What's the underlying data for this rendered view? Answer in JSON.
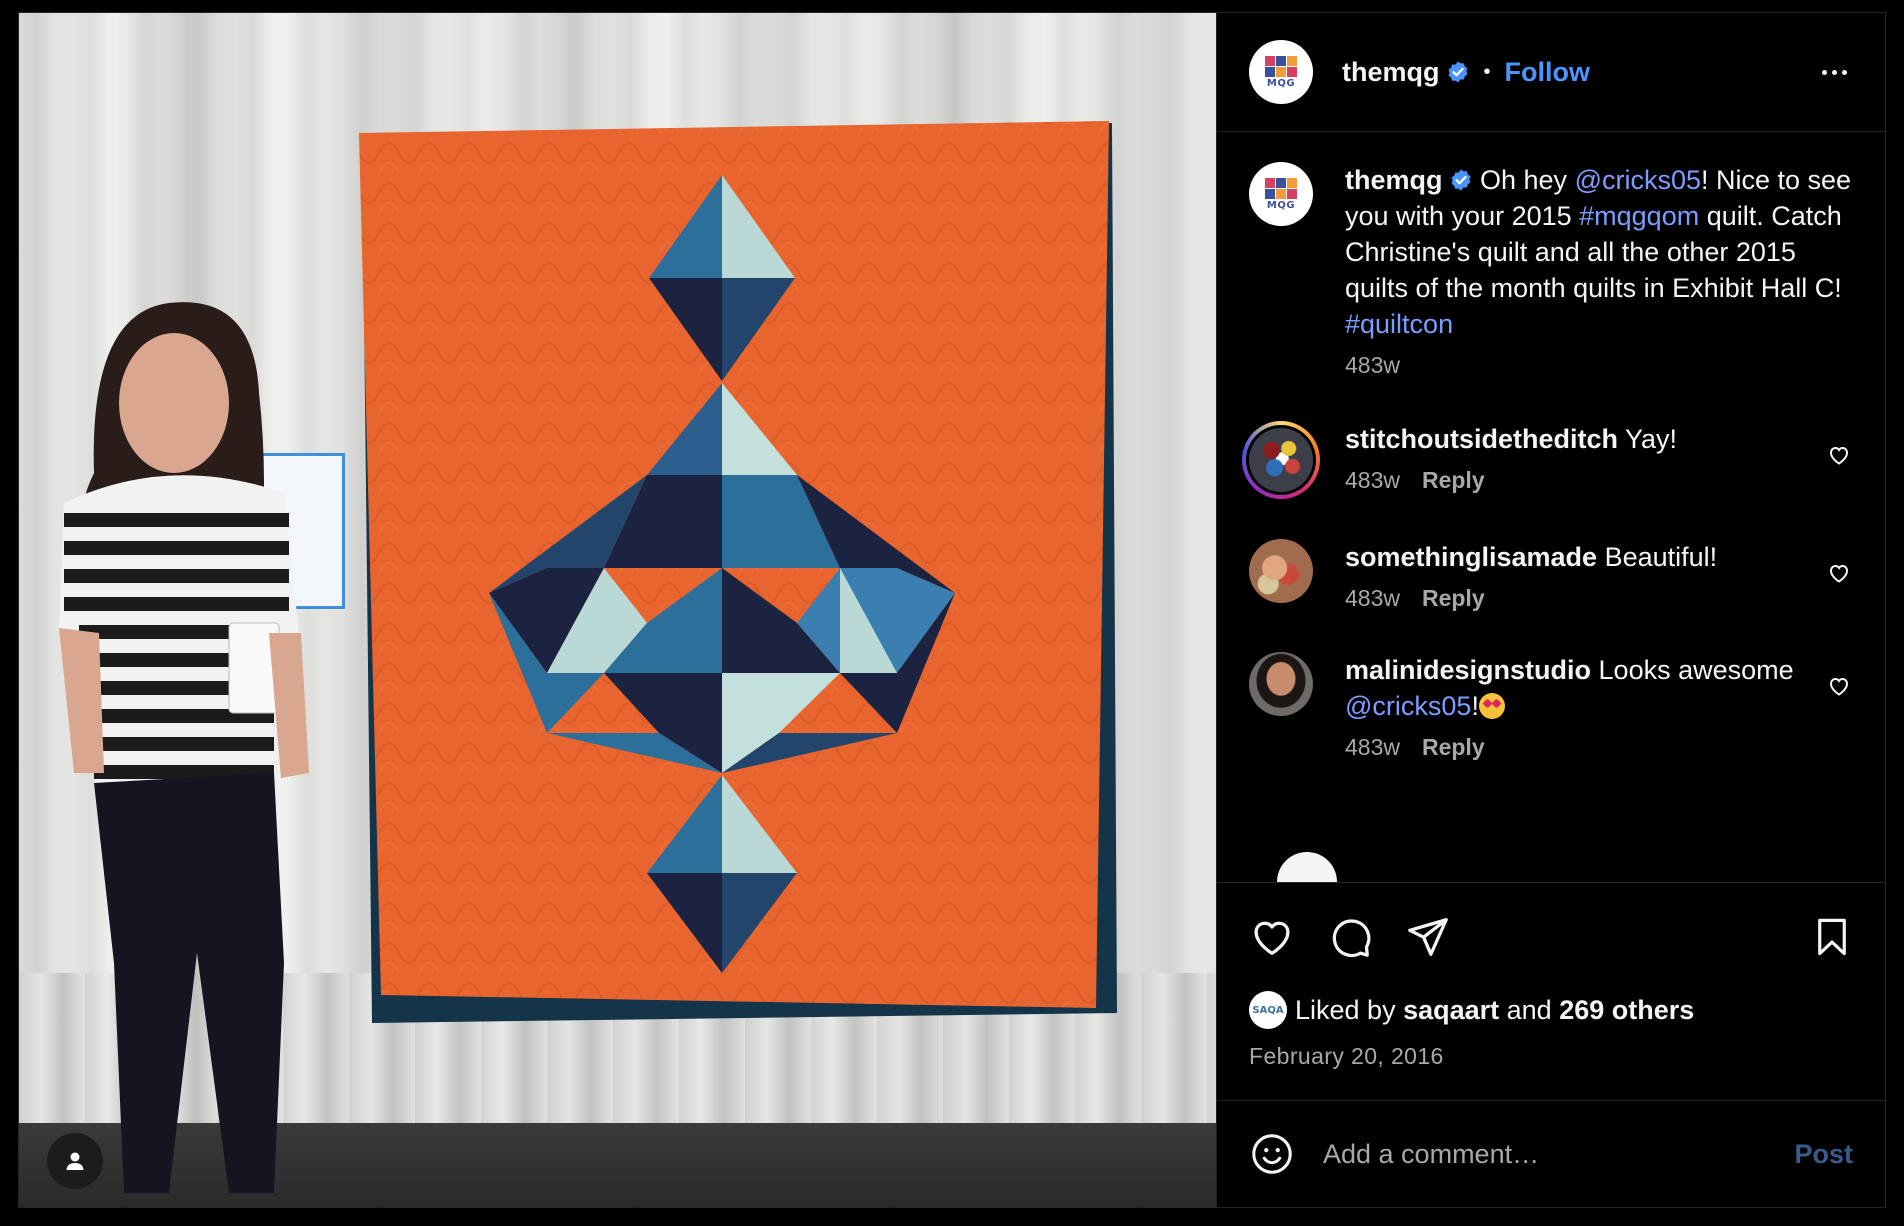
{
  "post": {
    "account": {
      "username": "themqg",
      "verified": true,
      "follow_label": "Follow",
      "avatar_text": "MQG",
      "avatar_colors": [
        "#d64161",
        "#3b4fa0",
        "#f29d38"
      ]
    },
    "separator": "•",
    "caption": {
      "username": "themqg",
      "text_1": " Oh hey ",
      "mention": "@cricks05",
      "text_2": "! Nice to see you with your 2015 ",
      "hashtag_1": "#mqgqom",
      "text_3": " quilt. Catch Christine's quilt and all the other 2015 quilts of the month quilts in Exhibit Hall C! ",
      "hashtag_2": "#quiltcon",
      "age": "483w"
    },
    "comments": [
      {
        "username": "stitchoutsidetheditch",
        "text": " Yay!",
        "age": "483w",
        "reply_label": "Reply",
        "has_story": true
      },
      {
        "username": "somethinglisamade",
        "text": " Beautiful!",
        "age": "483w",
        "reply_label": "Reply",
        "has_story": false
      },
      {
        "username": "malinidesignstudio",
        "text_1": " Looks awesome ",
        "mention": "@cricks05",
        "text_2": "!",
        "emoji": "heart-eyes-emoji",
        "age": "483w",
        "reply_label": "Reply",
        "has_story": false
      }
    ],
    "likes": {
      "prefix": "Liked by ",
      "user": "saqaart",
      "middle": " and ",
      "others": "269 others",
      "avatar_text": "SAQA"
    },
    "date": "February 20, 2016",
    "comment_box": {
      "placeholder": "Add a comment…",
      "post_label": "Post"
    },
    "icons": {
      "like": "heart-icon",
      "comment": "speech-bubble-icon",
      "share": "paper-plane-icon",
      "save": "bookmark-icon",
      "emoji": "smiley-icon",
      "more": "more-horizontal-icon",
      "tag": "user-tag-icon"
    },
    "colors": {
      "link": "#7d9cff",
      "follow": "#4a94ff",
      "quilt_orange": "#e8652f",
      "quilt_navy": "#1c2341",
      "quilt_teal": "#2c6f9a",
      "quilt_light": "#b9d8d6"
    }
  }
}
